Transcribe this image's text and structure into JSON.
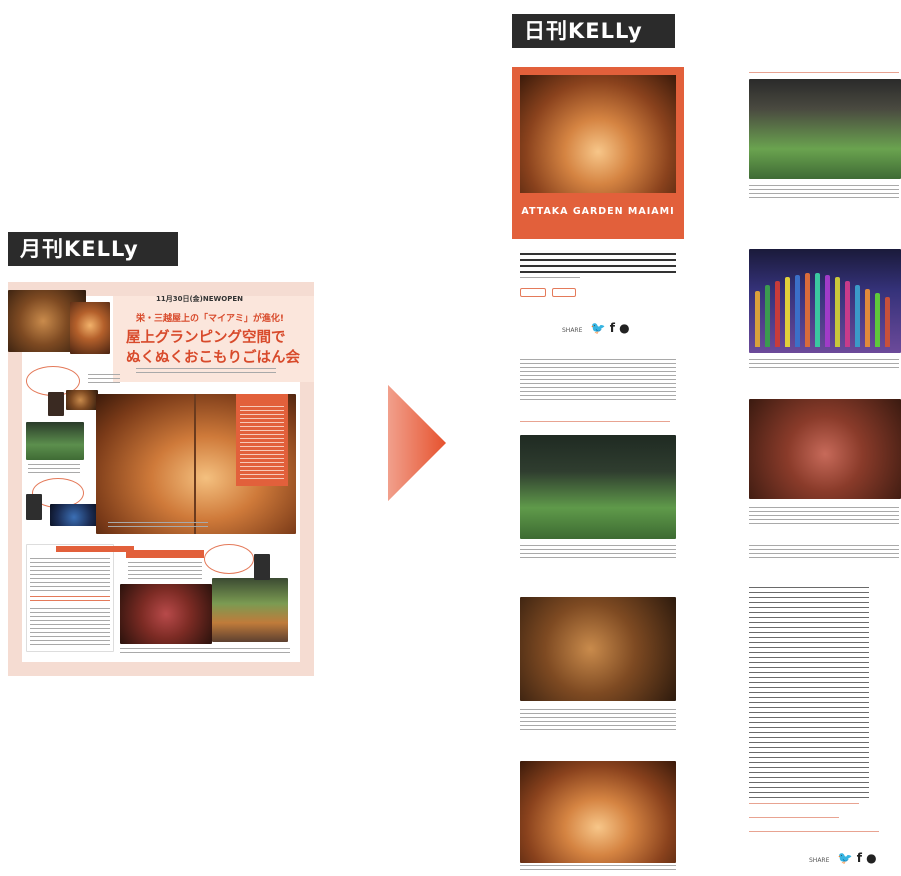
{
  "labels": {
    "monthly": "月刊KELLy",
    "daily": "日刊KELLy"
  },
  "magazine": {
    "newopen": "11月30日(金)NEWOPEN",
    "subtitle": "栄・三越屋上の「マイアミ」が進化!",
    "title_line1": "屋上グランピング空間で",
    "title_line2": "ぬくぬくおこもりごはん会"
  },
  "web": {
    "hero_name": "ATTAKA GARDEN MAIAMI",
    "share_label": "SHARE"
  },
  "colors": {
    "accent": "#e2603b",
    "label_bg": "#2b2b2b",
    "pink_bg": "#f5dcd2"
  },
  "icons": [
    "twitter-icon",
    "facebook-icon",
    "line-icon",
    "arrow-right-icon"
  ]
}
